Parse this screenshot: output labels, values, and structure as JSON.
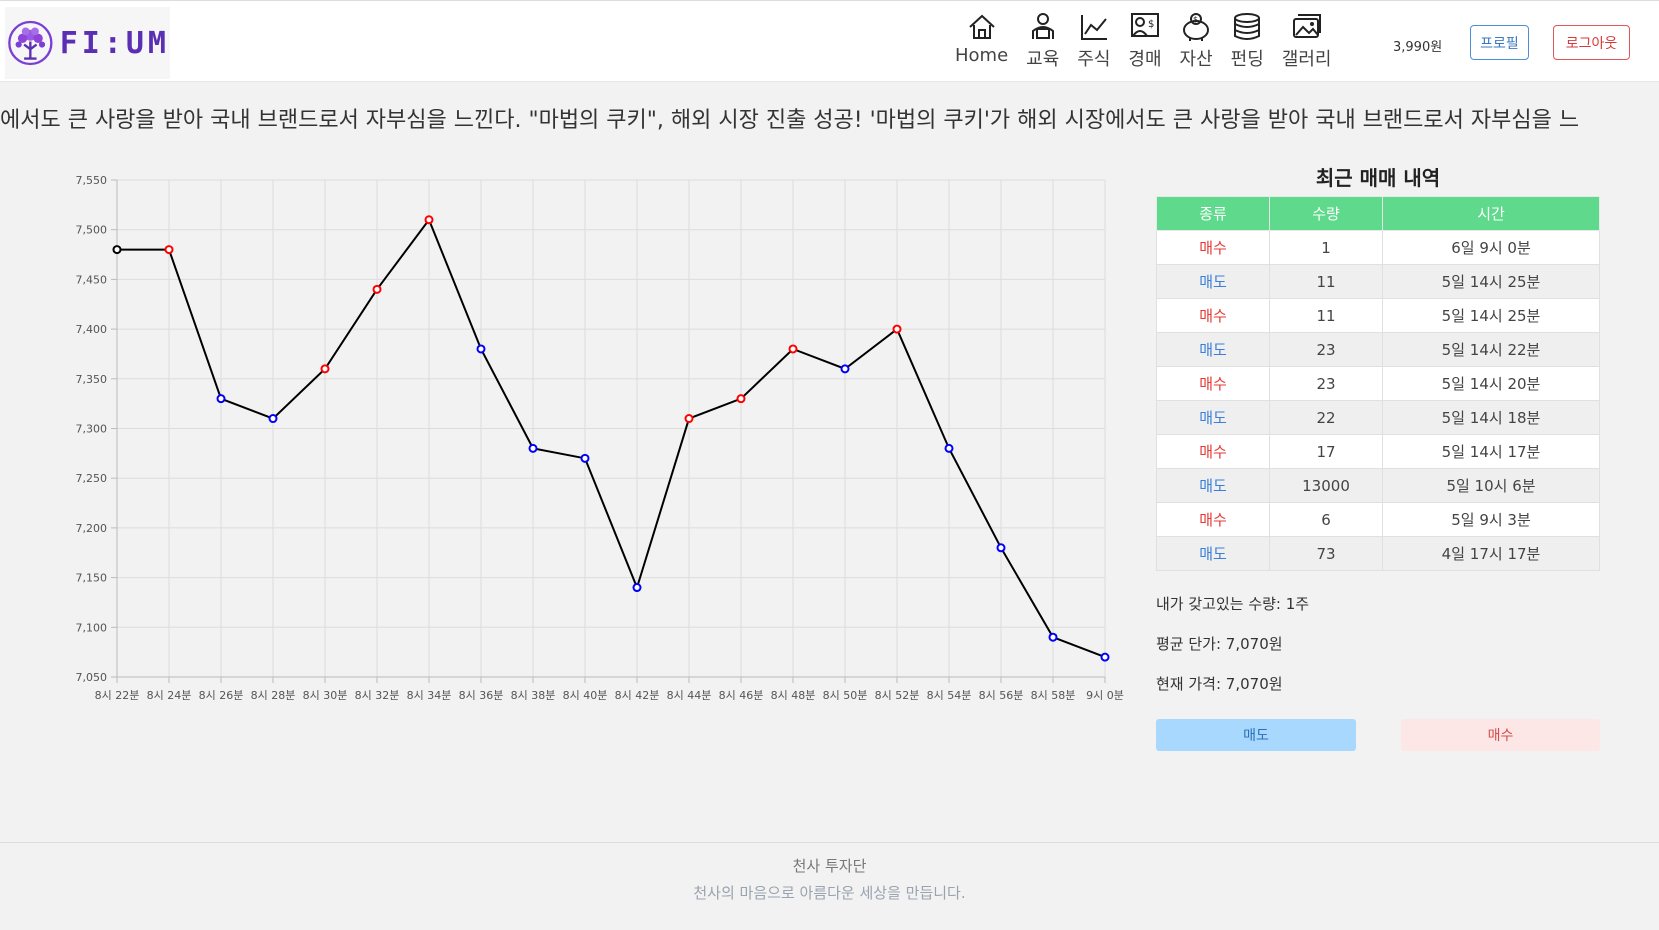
{
  "brand": {
    "name": "FI:UM"
  },
  "nav": [
    {
      "label": "Home",
      "icon": "home-icon"
    },
    {
      "label": "교육",
      "icon": "education-icon"
    },
    {
      "label": "주식",
      "icon": "stock-chart-icon"
    },
    {
      "label": "경매",
      "icon": "auction-icon"
    },
    {
      "label": "자산",
      "icon": "piggy-bank-icon"
    },
    {
      "label": "펀딩",
      "icon": "coins-icon"
    },
    {
      "label": "갤러리",
      "icon": "gallery-icon"
    }
  ],
  "header": {
    "balance": "3,990원",
    "profile_label": "프로필",
    "logout_label": "로그아웃"
  },
  "ticker": {
    "text": "에서도 큰 사랑을 받아 국내 브랜드로서 자부심을 느낀다. \"마법의 쿠키\", 해외 시장 진출 성공! '마법의 쿠키'가 해외 시장에서도 큰 사랑을 받아 국내 브랜드로서 자부심을 느"
  },
  "chart_data": {
    "type": "line",
    "x": [
      "8시 22분",
      "8시 24분",
      "8시 26분",
      "8시 28분",
      "8시 30분",
      "8시 32분",
      "8시 34분",
      "8시 36분",
      "8시 38분",
      "8시 40분",
      "8시 42분",
      "8시 44분",
      "8시 46분",
      "8시 48분",
      "8시 50분",
      "8시 52분",
      "8시 54분",
      "8시 56분",
      "8시 58분",
      "9시 0분"
    ],
    "series": [
      {
        "values": [
          7480,
          7480,
          7330,
          7310,
          7360,
          7440,
          7510,
          7380,
          7280,
          7270,
          7140,
          7310,
          7330,
          7380,
          7360,
          7400,
          7280,
          7180,
          7090,
          7070
        ]
      }
    ],
    "point_colors": [
      "#000000",
      "#ff0000",
      "#0000ff",
      "#0000ff",
      "#ff0000",
      "#ff0000",
      "#ff0000",
      "#0000ff",
      "#0000ff",
      "#0000ff",
      "#0000ff",
      "#ff0000",
      "#ff0000",
      "#ff0000",
      "#0000ff",
      "#ff0000",
      "#0000ff",
      "#0000ff",
      "#0000ff",
      "#0000ff"
    ],
    "ylim": [
      7050,
      7550
    ],
    "yticks": [
      "7,050",
      "7,100",
      "7,150",
      "7,200",
      "7,250",
      "7,300",
      "7,350",
      "7,400",
      "7,450",
      "7,500",
      "7,550"
    ],
    "grid": true,
    "line_color": "#000000"
  },
  "trades": {
    "title": "최근 매매 내역",
    "headers": [
      "종류",
      "수량",
      "시간"
    ],
    "rows": [
      [
        "매수",
        "1",
        "6일 9시 0분"
      ],
      [
        "매도",
        "11",
        "5일 14시 25분"
      ],
      [
        "매수",
        "11",
        "5일 14시 25분"
      ],
      [
        "매도",
        "23",
        "5일 14시 22분"
      ],
      [
        "매수",
        "23",
        "5일 14시 20분"
      ],
      [
        "매도",
        "22",
        "5일 14시 18분"
      ],
      [
        "매수",
        "17",
        "5일 14시 17분"
      ],
      [
        "매도",
        "13000",
        "5일 10시 6분"
      ],
      [
        "매수",
        "6",
        "5일 9시 3분"
      ],
      [
        "매도",
        "73",
        "4일 17시 17분"
      ]
    ]
  },
  "holdings": {
    "quantity": "내가 갖고있는 수량: 1주",
    "avg_price": "평균 단가: 7,070원",
    "current_price": "현재 가격: 7,070원"
  },
  "actions": {
    "sell_label": "매도",
    "buy_label": "매수"
  },
  "footer": {
    "title": "천사 투자단",
    "subtitle": "천사의 마음으로 아름다운 세상을 만듭니다."
  },
  "colors": {
    "buy": "#e53935",
    "sell": "#3b7fd8",
    "table_header": "#5fd98b",
    "brand": "#5b2fb3"
  }
}
